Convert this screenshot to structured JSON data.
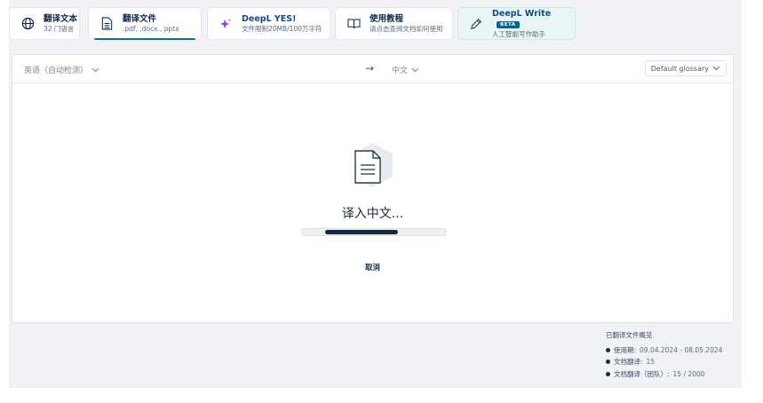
{
  "tabs": [
    {
      "title": "翻译文本",
      "subtitle": "32 门语言",
      "icon": "globe-icon"
    },
    {
      "title": "翻译文件",
      "subtitle": ".pdf, .docx., pptx",
      "icon": "document-icon",
      "active": true
    },
    {
      "title": "DeepL YES!",
      "subtitle": "文件限制20MB/100万字符",
      "icon": "sparkle-icon"
    },
    {
      "title": "使用教程",
      "subtitle": "请点击查阅文档如何使用",
      "icon": "book-icon"
    },
    {
      "title": "DeepL Write",
      "badge": "BETA",
      "subtitle": "人工智能写作助手",
      "icon": "pen-icon"
    }
  ],
  "langbar": {
    "source": "英语（自动检测）",
    "arrow": "→",
    "target": "中文",
    "glossary": "Default glossary"
  },
  "status": {
    "message": "译入中文...",
    "progress": 0.5,
    "cancel": "取消"
  },
  "summary": {
    "title": "已翻译文件概览",
    "rows": [
      {
        "label": "使用期:",
        "value": "09.04.2024 - 08.05.2024"
      },
      {
        "label": "文档翻译:",
        "value": "15"
      },
      {
        "label": "文档翻译（团队）:",
        "value": "15 / 2000"
      }
    ]
  },
  "colors": {
    "accent": "#0f6fb6",
    "navy": "#0f2b46",
    "badge": "#006494",
    "sparkle": "#9b3df0"
  }
}
